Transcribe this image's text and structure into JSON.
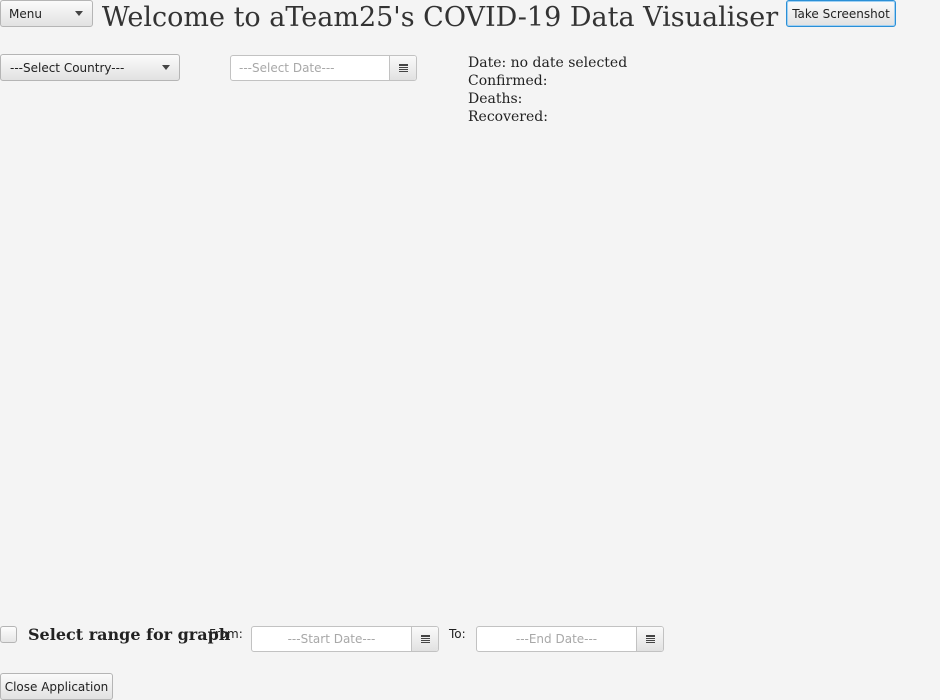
{
  "header": {
    "menu_label": "Menu",
    "title": "Welcome to aTeam25's COVID-19 Data Visualiser",
    "screenshot_label": "Take Screenshot"
  },
  "controls": {
    "country_select_value": "---Select Country---",
    "date_placeholder": "---Select Date---"
  },
  "info": {
    "date": "Date: no date selected",
    "confirmed": "Confirmed:",
    "deaths": "Deaths:",
    "recovered": "Recovered:"
  },
  "range": {
    "checkbox_label": "Select range for graph",
    "checked": false,
    "from_label": "From:",
    "start_placeholder": "---Start Date---",
    "to_label": "To:",
    "end_placeholder": "---End Date---"
  },
  "footer": {
    "close_label": "Close Application"
  },
  "icons": {
    "menu_arrow": "chevron-down-icon",
    "country_arrow": "chevron-down-icon",
    "date_picker": "calendar-icon"
  }
}
